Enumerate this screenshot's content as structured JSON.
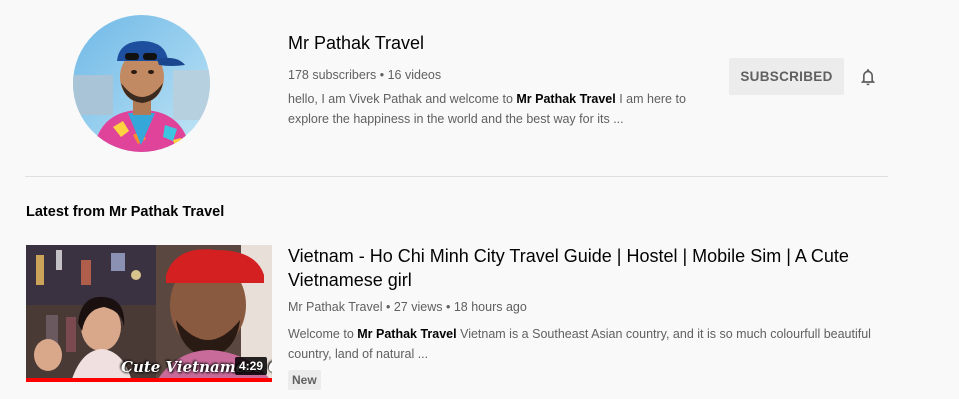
{
  "channel": {
    "name": "Mr Pathak Travel",
    "subscribers": "178 subscribers",
    "separator": "•",
    "videos": "16 videos",
    "description_prefix": "hello, I am Vivek Pathak and welcome to ",
    "description_bold": "Mr Pathak Travel",
    "description_suffix": " I am here to explore the happiness in the world and the best way for its ...",
    "subscribe_label": "SUBSCRIBED",
    "bell_icon": "bell-icon"
  },
  "section": {
    "title": "Latest from Mr Pathak Travel"
  },
  "video": {
    "title": "Vietnam - Ho Chi Minh City Travel Guide | Hostel | Mobile Sim | A Cute Vietnamese girl",
    "author": "Mr Pathak Travel",
    "views": "27 views",
    "age": "18 hours ago",
    "description_prefix": "Welcome to ",
    "description_bold": "Mr Pathak Travel",
    "description_suffix": " Vietnam is a Southeast Asian country, and it is so much colourfull beautiful country, land of natural ...",
    "badge": "New",
    "duration": "4:29",
    "thumbnail_text": "Cute Vietnamese G",
    "watched_fraction": 1.0
  },
  "colors": {
    "background": "#f9f9f9",
    "primary_text": "#030303",
    "secondary_text": "#606060",
    "subscribed_bg": "#ececec",
    "progress": "#ff0000"
  }
}
